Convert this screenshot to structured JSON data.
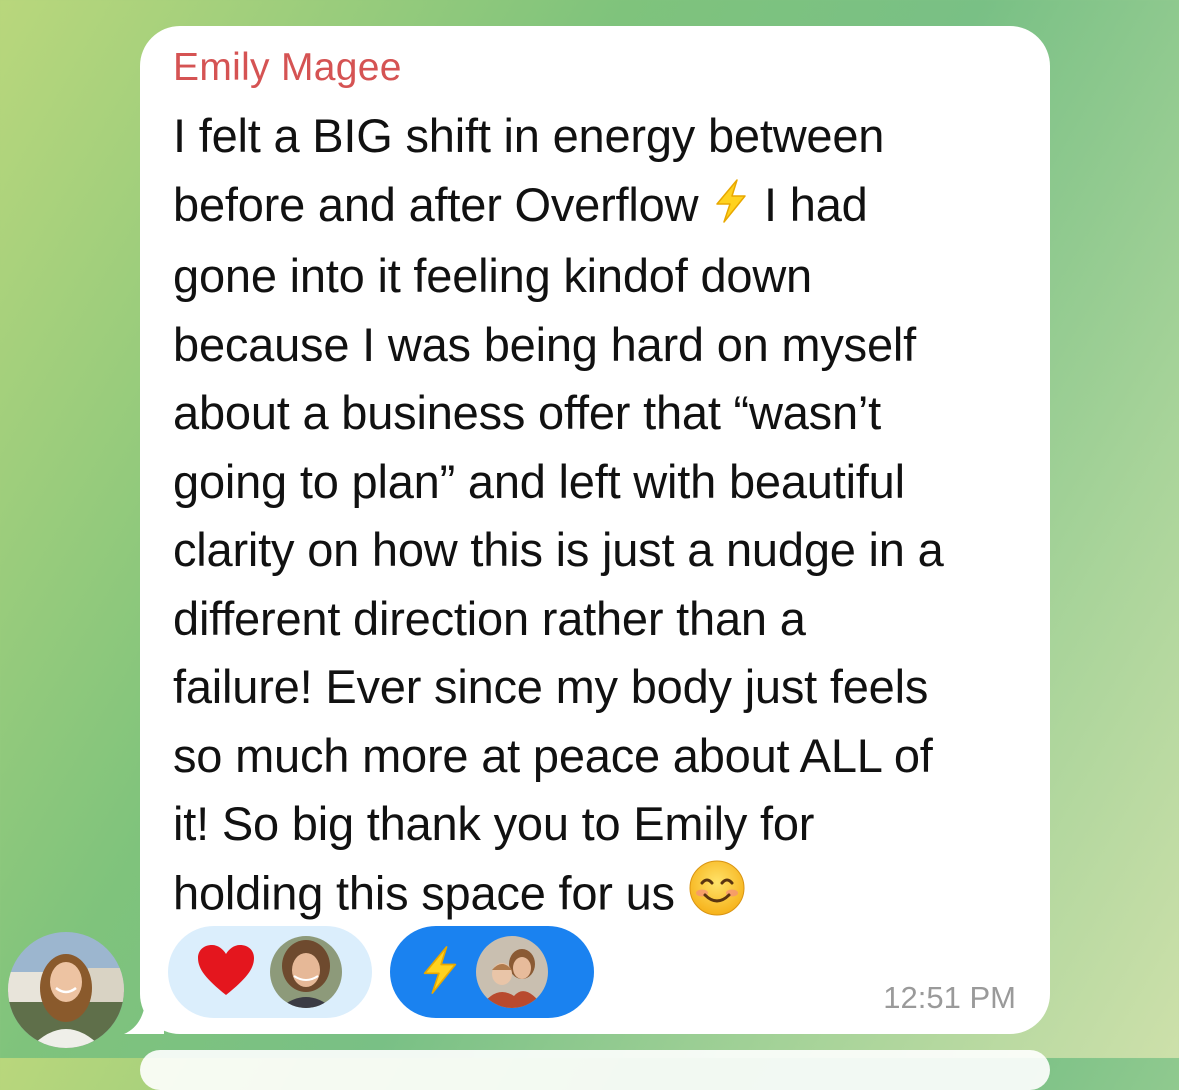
{
  "message": {
    "sender": "Emily Magee",
    "text_before_bolt": "I felt a BIG shift in energy between\nbefore and after Overflow ",
    "text_after_bolt": " I had\ngone into it feeling kindof down\nbecause I was being hard on myself\nabout a business offer that “wasn’t\ngoing to plan” and left with beautiful\nclarity on how this is just a nudge in a\ndifferent direction rather than a\nfailure! Ever since my body just feels\nso much more at peace about ALL of\nit! So big thank you to Emily for\nholding this space for us ",
    "inline_emojis": [
      "lightning-emoji",
      "smiling-face-emoji"
    ],
    "timestamp": "12:51 PM"
  },
  "reactions": [
    {
      "emoji": "heart",
      "background": "#dbeefc",
      "reactor": "avatar"
    },
    {
      "emoji": "lightning",
      "background": "#1a82f0",
      "reactor": "avatar"
    }
  ],
  "colors": {
    "sender": "#d55353",
    "bubble": "#ffffff",
    "text": "#111111",
    "timestamp": "#9a9a9a"
  }
}
